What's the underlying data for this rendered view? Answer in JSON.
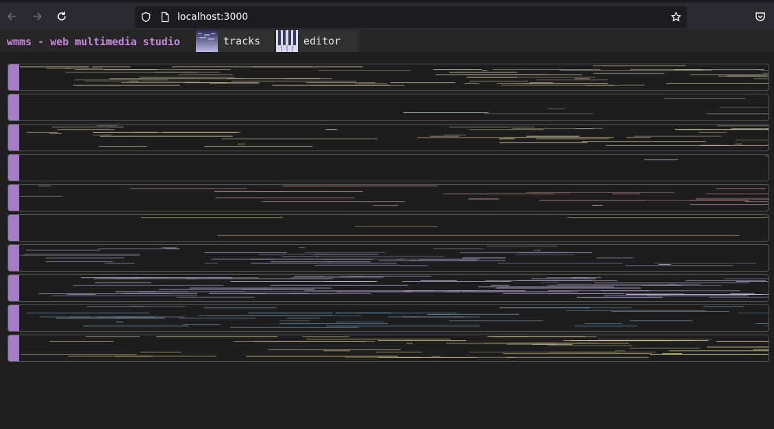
{
  "browser": {
    "url": "localhost:3000",
    "icons": [
      "back-arrow-icon",
      "forward-arrow-icon",
      "reload-icon",
      "shield-icon",
      "page-icon",
      "bookmark-star-icon",
      "pocket-icon"
    ]
  },
  "app": {
    "title": "wmms - web multimedia studio",
    "tabs": [
      {
        "label": "tracks",
        "icon": "tracks-thumbnail-icon"
      },
      {
        "label": "editor",
        "icon": "piano-keys-icon"
      }
    ]
  },
  "tracks": [
    {
      "color": "#d8c9a8"
    },
    {
      "color": "#7fb0a0"
    },
    {
      "color": "#d8c49a"
    },
    {
      "color": "#8c9bc0"
    },
    {
      "color": "#d49a9a"
    },
    {
      "color": "#e0c080"
    },
    {
      "color": "#a8a8d0"
    },
    {
      "color": "#c8b8e8"
    },
    {
      "color": "#80a8c8"
    },
    {
      "color": "#d8c88a"
    }
  ],
  "theme": {
    "accent": "#a67cc9",
    "title_color": "#c98be0",
    "background": "#1f1f1f"
  }
}
